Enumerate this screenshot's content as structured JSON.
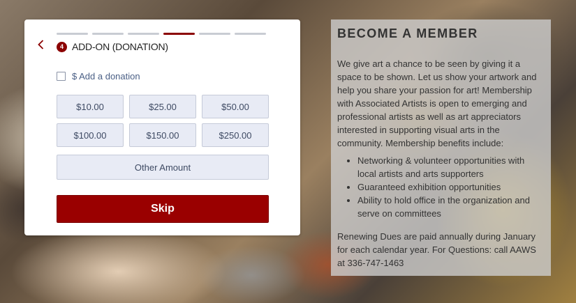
{
  "progress": {
    "total_steps": 6,
    "current_step": 4
  },
  "header": {
    "step_number": "4",
    "step_title": "ADD-ON (DONATION)"
  },
  "donation": {
    "checkbox_label": "$ Add a donation",
    "checked": false,
    "amounts": [
      "$10.00",
      "$25.00",
      "$50.00",
      "$100.00",
      "$150.00",
      "$250.00"
    ],
    "other_label": "Other Amount"
  },
  "skip_label": "Skip",
  "info": {
    "title": "BECOME A MEMBER",
    "intro": "We give art a chance to be seen by giving it a space to be shown. Let us show your artwork and help you share your passion for art! Membership with Associated Artists is open to emerging and professional artists as well as art appreciators interested in supporting visual arts in the community. Membership benefits include:",
    "benefits": [
      "Networking & volunteer opportunities with local artists and arts supporters",
      "Guaranteed exhibition opportunities",
      "Ability to hold office in the organization and serve on committees"
    ],
    "footer": "Renewing Dues are paid annually during January for each calendar year. For Questions: call AAWS at 336-747-1463"
  },
  "colors": {
    "accent": "#8b0000",
    "button_bg": "#e8ebf5",
    "link_text": "#4a5f85"
  }
}
